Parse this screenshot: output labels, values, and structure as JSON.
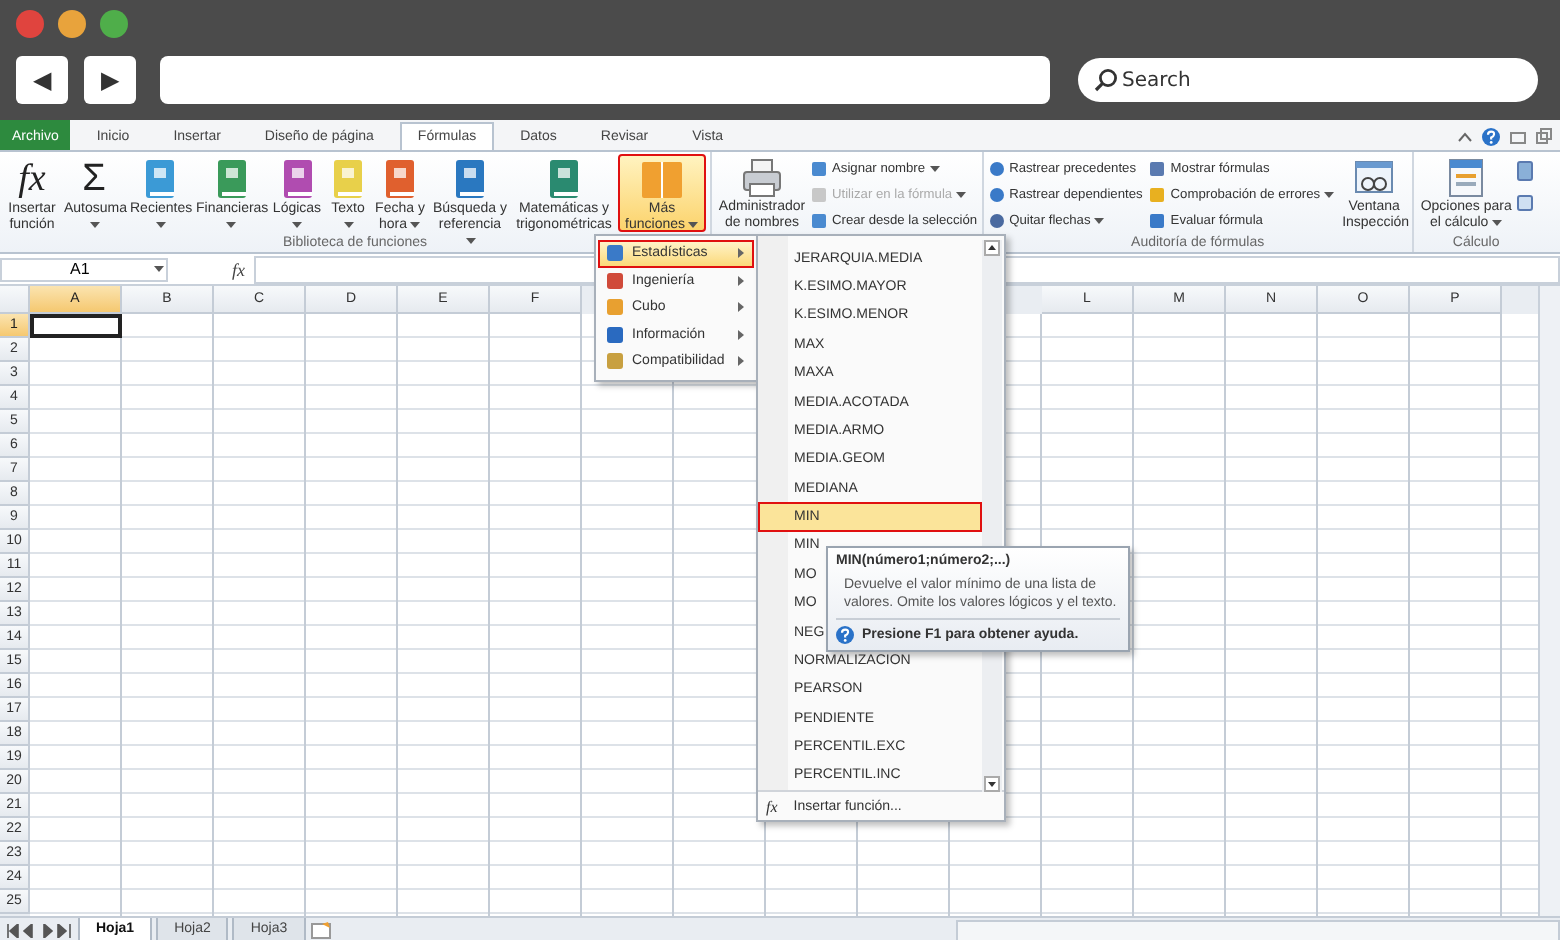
{
  "browser": {
    "window_controls": [
      {
        "color": "#e0443e"
      },
      {
        "color": "#e8a33c"
      },
      {
        "color": "#4fae4a"
      }
    ],
    "back": "◀",
    "forward": "▶",
    "search": {
      "placeholder": "Search"
    }
  },
  "tabs": [
    {
      "label": "Archivo",
      "kind": "file",
      "selected": false
    },
    {
      "label": "Inicio",
      "kind": "tab",
      "selected": false
    },
    {
      "label": "Insertar",
      "kind": "tab",
      "selected": false
    },
    {
      "label": "Diseño de página",
      "kind": "tab",
      "selected": false
    },
    {
      "label": "Fórmulas",
      "kind": "tab",
      "selected": true
    },
    {
      "label": "Datos",
      "kind": "tab",
      "selected": false
    },
    {
      "label": "Revisar",
      "kind": "tab",
      "selected": false
    },
    {
      "label": "Vista",
      "kind": "tab",
      "selected": false
    }
  ],
  "ribbon": {
    "library": {
      "label": "Biblioteca de funciones",
      "buttons": [
        {
          "label": "Insertar función",
          "kind": "glyph",
          "glyph": "fx",
          "dropdown": false,
          "selected": false,
          "highlighted": false
        },
        {
          "label": "Autosuma",
          "kind": "glyph",
          "glyph": "Σ",
          "dropdown": true,
          "selected": false,
          "highlighted": false
        },
        {
          "label": "Recientes",
          "kind": "book",
          "color": "#3b9ad6",
          "dropdown": true,
          "selected": false,
          "highlighted": false
        },
        {
          "label": "Financieras",
          "kind": "book",
          "color": "#3a9a5a",
          "dropdown": true,
          "selected": false,
          "highlighted": false
        },
        {
          "label": "Lógicas",
          "kind": "book",
          "color": "#b04cb0",
          "dropdown": true,
          "selected": false,
          "highlighted": false
        },
        {
          "label": "Texto",
          "kind": "book",
          "color": "#e8d04a",
          "dropdown": true,
          "selected": false,
          "highlighted": false
        },
        {
          "label": "Fecha y hora",
          "kind": "book",
          "color": "#e0602e",
          "dropdown": true,
          "selected": false,
          "highlighted": false
        },
        {
          "label": "Búsqueda y referencia",
          "kind": "book",
          "color": "#2a78c0",
          "dropdown": true,
          "selected": false,
          "highlighted": false
        },
        {
          "label": "Matemáticas y trigonométricas",
          "kind": "book",
          "color": "#2a8a70",
          "dropdown": false,
          "selected": false,
          "highlighted": false
        },
        {
          "label": "Más funciones",
          "kind": "books",
          "color": "#f0a030",
          "dropdown": true,
          "selected": true,
          "highlighted": true
        }
      ]
    },
    "names": {
      "manager": "Administrador de nombres",
      "items": [
        {
          "label": "Asignar nombre",
          "dropdown": true,
          "disabled": false
        },
        {
          "label": "Utilizar en la fórmula",
          "dropdown": true,
          "disabled": true
        },
        {
          "label": "Crear desde la selección",
          "dropdown": false,
          "disabled": false
        }
      ]
    },
    "auditing": {
      "label": "Auditoría de fórmulas",
      "items": [
        {
          "label": "Rastrear precedentes",
          "dropdown": false
        },
        {
          "label": "Rastrear dependientes",
          "dropdown": false
        },
        {
          "label": "Quitar flechas",
          "dropdown": true
        },
        {
          "label": "Mostrar fórmulas",
          "dropdown": false
        },
        {
          "label": "Comprobación de errores",
          "dropdown": true
        },
        {
          "label": "Evaluar fórmula",
          "dropdown": false
        }
      ],
      "watch": "Ventana Inspección"
    },
    "calculation": {
      "label": "Cálculo",
      "options": "Opciones para el cálculo"
    }
  },
  "formula_bar": {
    "name_box": "A1",
    "fx": "fx"
  },
  "sheet": {
    "columns_left": [
      {
        "label": "A",
        "selected": true
      },
      {
        "label": "B",
        "selected": false
      },
      {
        "label": "C",
        "selected": false
      },
      {
        "label": "D",
        "selected": false
      },
      {
        "label": "E",
        "selected": false
      },
      {
        "label": "F",
        "selected": false
      }
    ],
    "columns_right": [
      {
        "label": "L",
        "selected": false
      },
      {
        "label": "M",
        "selected": false
      },
      {
        "label": "N",
        "selected": false
      },
      {
        "label": "O",
        "selected": false
      },
      {
        "label": "P",
        "selected": false
      }
    ],
    "rows": [
      {
        "label": "1",
        "selected": true
      },
      {
        "label": "2",
        "selected": false
      },
      {
        "label": "3",
        "selected": false
      },
      {
        "label": "4",
        "selected": false
      },
      {
        "label": "5",
        "selected": false
      },
      {
        "label": "6",
        "selected": false
      },
      {
        "label": "7",
        "selected": false
      },
      {
        "label": "8",
        "selected": false
      },
      {
        "label": "9",
        "selected": false
      },
      {
        "label": "10",
        "selected": false
      },
      {
        "label": "11",
        "selected": false
      },
      {
        "label": "12",
        "selected": false
      },
      {
        "label": "13",
        "selected": false
      },
      {
        "label": "14",
        "selected": false
      },
      {
        "label": "15",
        "selected": false
      },
      {
        "label": "16",
        "selected": false
      },
      {
        "label": "17",
        "selected": false
      },
      {
        "label": "18",
        "selected": false
      },
      {
        "label": "19",
        "selected": false
      },
      {
        "label": "20",
        "selected": false
      },
      {
        "label": "21",
        "selected": false
      },
      {
        "label": "22",
        "selected": false
      },
      {
        "label": "23",
        "selected": false
      },
      {
        "label": "24",
        "selected": false
      },
      {
        "label": "25",
        "selected": false
      }
    ]
  },
  "sheet_tabs": [
    {
      "label": "Hoja1",
      "selected": true
    },
    {
      "label": "Hoja2",
      "selected": false
    },
    {
      "label": "Hoja3",
      "selected": false
    }
  ],
  "function_menu": {
    "categories": [
      {
        "label": "Estadísticas",
        "color": "#3a7ac8",
        "selected": true,
        "highlighted": true
      },
      {
        "label": "Ingeniería",
        "color": "#d04a3a",
        "selected": false,
        "highlighted": false
      },
      {
        "label": "Cubo",
        "color": "#e8a030",
        "selected": false,
        "highlighted": false
      },
      {
        "label": "Información",
        "color": "#2a6ac0",
        "selected": false,
        "highlighted": false
      },
      {
        "label": "Compatibilidad",
        "color": "#c8a040",
        "selected": false,
        "highlighted": false
      }
    ],
    "functions": [
      {
        "label": "JERARQUIA.MEDIA",
        "selected": false,
        "highlighted": false
      },
      {
        "label": "K.ESIMO.MAYOR",
        "selected": false,
        "highlighted": false
      },
      {
        "label": "K.ESIMO.MENOR",
        "selected": false,
        "highlighted": false
      },
      {
        "label": "MAX",
        "selected": false,
        "highlighted": false
      },
      {
        "label": "MAXA",
        "selected": false,
        "highlighted": false
      },
      {
        "label": "MEDIA.ACOTADA",
        "selected": false,
        "highlighted": false
      },
      {
        "label": "MEDIA.ARMO",
        "selected": false,
        "highlighted": false
      },
      {
        "label": "MEDIA.GEOM",
        "selected": false,
        "highlighted": false
      },
      {
        "label": "MEDIANA",
        "selected": false,
        "highlighted": false
      },
      {
        "label": "MIN",
        "selected": true,
        "highlighted": true
      },
      {
        "label": "MIN",
        "selected": false,
        "highlighted": false
      },
      {
        "label": "MO",
        "selected": false,
        "highlighted": false
      },
      {
        "label": "MO",
        "selected": false,
        "highlighted": false
      },
      {
        "label": "NEG",
        "selected": false,
        "highlighted": false
      },
      {
        "label": "NORMALIZACION",
        "selected": false,
        "highlighted": false
      },
      {
        "label": "PEARSON",
        "selected": false,
        "highlighted": false
      },
      {
        "label": "PENDIENTE",
        "selected": false,
        "highlighted": false
      },
      {
        "label": "PERCENTIL.EXC",
        "selected": false,
        "highlighted": false
      },
      {
        "label": "PERCENTIL.INC",
        "selected": false,
        "highlighted": false
      }
    ],
    "footer": {
      "glyph": "fx",
      "label": "Insertar función..."
    }
  },
  "tooltip": {
    "title": "MIN(número1;número2;...)",
    "body": "Devuelve el valor mínimo de una lista de valores. Omite los valores lógicos y el texto.",
    "help": "Presione F1 para obtener ayuda."
  }
}
